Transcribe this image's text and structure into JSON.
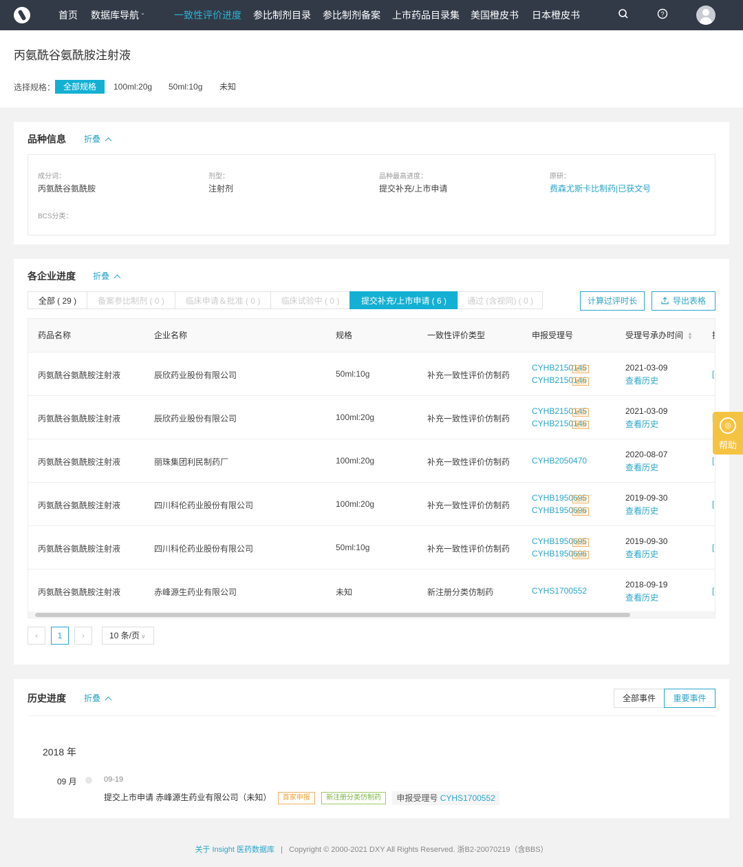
{
  "nav": {
    "items": [
      "首页",
      "数据库导航",
      "一致性评价进度",
      "参比制剂目录",
      "参比制剂备案",
      "上市药品目录集",
      "美国橙皮书",
      "日本橙皮书"
    ],
    "active_index": 2,
    "dropdown_caret": "ˇ",
    "search_icon": "search-icon",
    "help_icon": "question-circle-icon",
    "accent": "#2db3d2",
    "bg": "#323a48"
  },
  "page": {
    "title": "丙氨酰谷氨酰胺注射液",
    "spec_label": "选择规格：",
    "specs": [
      "全部规格",
      "100ml:20g",
      "50ml:10g",
      "未知"
    ],
    "spec_selected": 0
  },
  "variety": {
    "title": "品种信息",
    "fold_label": "折叠",
    "fields": [
      {
        "label": "成分词：",
        "value": "丙氨酰谷氨酰胺"
      },
      {
        "label": "剂型：",
        "value": "注射剂"
      },
      {
        "label": "品种最高进度：",
        "value": "提交补充/上市申请"
      },
      {
        "label": "原研：",
        "value": "费森尤斯卡比制药|已获文号"
      },
      {
        "label": "BCS分类：",
        "value": ""
      }
    ]
  },
  "progress": {
    "title": "各企业进度",
    "fold_label": "折叠",
    "tabs": [
      "全部 ( 29 )",
      "备案参比制剂 ( 0 )",
      "临床申请＆批准 ( 0 )",
      "临床试验中 ( 0 )",
      "提交补充/上市申请 ( 6 )",
      "通过 (含视同) ( 0 )"
    ],
    "tab_selected": 4,
    "calc_button": "计算过评时长",
    "export_button": "导出表格",
    "columns": [
      "药品名称",
      "企业名称",
      "规格",
      "一致性评价类型",
      "申报受理号",
      "受理号承办时间",
      "操"
    ],
    "rows": [
      {
        "drug": "丙氨酰谷氨酰胺注射液",
        "company": "辰欣药业股份有限公司",
        "spec": "50ml:10g",
        "type": "补充一致性评价仿制药",
        "codes": [
          "CYHB2150145",
          "CYHB2150146"
        ],
        "tag": "推测",
        "date": "2021-03-09",
        "history": "查看历史"
      },
      {
        "drug": "丙氨酰谷氨酰胺注射液",
        "company": "辰欣药业股份有限公司",
        "spec": "100ml:20g",
        "type": "补充一致性评价仿制药",
        "codes": [
          "CYHB2150145",
          "CYHB2150146"
        ],
        "tag": "推测",
        "date": "2021-03-09",
        "history": "查看历史"
      },
      {
        "drug": "丙氨酰谷氨酰胺注射液",
        "company": "丽珠集团利民制药厂",
        "spec": "100ml:20g",
        "type": "补充一致性评价仿制药",
        "codes": [
          "CYHB2050470"
        ],
        "tag": "",
        "date": "2020-08-07",
        "history": "查看历史"
      },
      {
        "drug": "丙氨酰谷氨酰胺注射液",
        "company": "四川科伦药业股份有限公司",
        "spec": "100ml:20g",
        "type": "补充一致性评价仿制药",
        "codes": [
          "CYHB1950695",
          "CYHB1950696"
        ],
        "tag": "推测",
        "date": "2019-09-30",
        "history": "查看历史"
      },
      {
        "drug": "丙氨酰谷氨酰胺注射液",
        "company": "四川科伦药业股份有限公司",
        "spec": "50ml:10g",
        "type": "补充一致性评价仿制药",
        "codes": [
          "CYHB1950695",
          "CYHB1950696"
        ],
        "tag": "推测",
        "date": "2019-09-30",
        "history": "查看历史"
      },
      {
        "drug": "丙氨酰谷氨酰胺注射液",
        "company": "赤峰源生药业有限公司",
        "spec": "未知",
        "type": "新注册分类仿制药",
        "codes": [
          "CYHS1700552"
        ],
        "tag": "",
        "date": "2018-09-19",
        "history": "查看历史"
      }
    ],
    "pagination": {
      "prev": "‹",
      "current": "1",
      "next": "›",
      "page_size": "10 条/页"
    }
  },
  "help": {
    "label": "帮助",
    "icon": "help-icon"
  },
  "history": {
    "title": "历史进度",
    "fold_label": "折叠",
    "toggle": [
      "全部事件",
      "重要事件"
    ],
    "toggle_selected": 1,
    "year": "2018 年",
    "month": "09 月",
    "event_date": "09-19",
    "event_action": "提交上市申请",
    "event_company": "赤峰源生药业有限公司（未知）",
    "tag_first": "首家申报",
    "tag_type": "新注册分类仿制药",
    "code_label": "申报受理号",
    "code": "CYHS1700552"
  },
  "footer": {
    "link": "关于 Insight 医药数据库",
    "separator": "|",
    "copyright": "Copyright © 2000-2021 DXY All Rights Reserved. 浙B2-20070219（含BBS）"
  }
}
